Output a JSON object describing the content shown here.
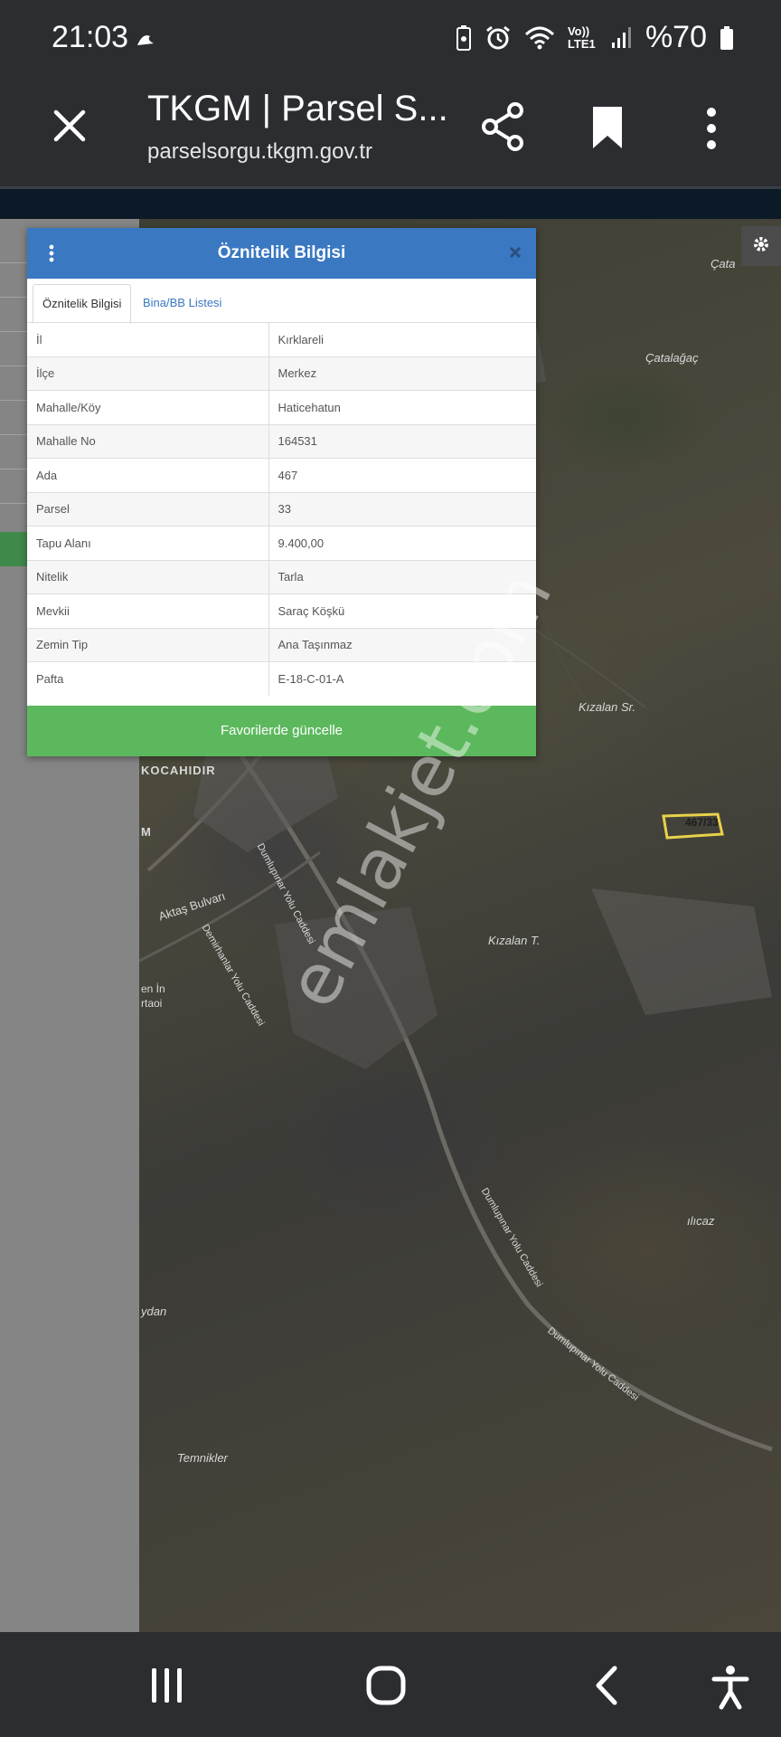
{
  "status": {
    "time": "21:03",
    "network": "Vo)) LTE1",
    "battery": "%70"
  },
  "browser": {
    "title": "TKGM | Parsel S...",
    "url": "parselsorgu.tkgm.gov.tr",
    "icons": [
      "close-icon",
      "share-icon",
      "bookmark-icon",
      "more-vert-icon"
    ]
  },
  "dialog": {
    "title": "Öznitelik Bilgisi",
    "tabs": [
      "Öznitelik Bilgisi",
      "Bina/BB Listesi"
    ],
    "rows": [
      {
        "key": "İl",
        "value": "Kırklareli"
      },
      {
        "key": "İlçe",
        "value": "Merkez"
      },
      {
        "key": "Mahalle/Köy",
        "value": "Haticehatun"
      },
      {
        "key": "Mahalle No",
        "value": "164531"
      },
      {
        "key": "Ada",
        "value": "467"
      },
      {
        "key": "Parsel",
        "value": "33"
      },
      {
        "key": "Tapu Alanı",
        "value": "9.400,00"
      },
      {
        "key": "Nitelik",
        "value": "Tarla"
      },
      {
        "key": "Mevkii",
        "value": "Saraç Köşkü"
      },
      {
        "key": "Zemin Tip",
        "value": "Ana Taşınmaz"
      },
      {
        "key": "Pafta",
        "value": "E-18-C-01-A"
      }
    ],
    "button": "Favorilerde güncelle",
    "colors": {
      "header": "#3a78c2",
      "button": "#5cb85c"
    }
  },
  "map": {
    "labels": {
      "catalagac_top": "Çata",
      "catalagac": "Çatalağaç",
      "kizalan_sr": "Kızalan Sr.",
      "parcel": "467/33",
      "kocahidir": "KOCAHIDIR",
      "m": "M",
      "aktas_bulvari": "Aktaş Bulvarı",
      "kizalan_t": "Kızalan T.",
      "ilicaz": "ılıcaz",
      "ydan": "ydan",
      "temnikler": "Temnikler",
      "street_1": "Dumlupınar Yolu Caddesi",
      "street_2": "Dumlupınar Yolu Caddesi",
      "street_3": "Dumlupınar Yolu Caddesi",
      "street_4": "Demirhanlar Yolu Caddesi",
      "left_1": "en İn",
      "left_2": "rtaoi"
    }
  },
  "watermark": "emlakjet.com",
  "nav": [
    "recent-apps-icon",
    "home-icon",
    "back-icon",
    "accessibility-icon"
  ]
}
